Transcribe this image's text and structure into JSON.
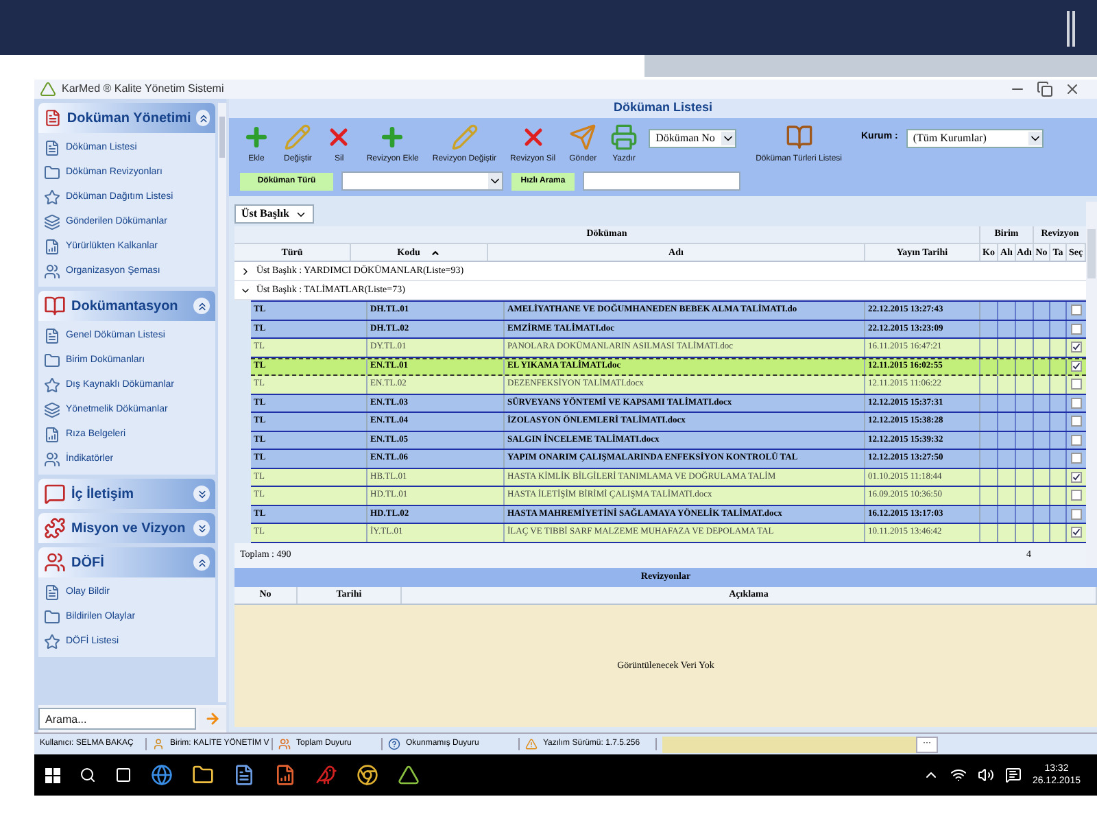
{
  "window": {
    "title": "KarMed ® Kalite Yönetim Sistemi"
  },
  "sidebar": {
    "sections": [
      {
        "title": "Doküman Yönetimi",
        "expanded": true,
        "items": [
          "Döküman Listesi",
          "Döküman Revizyonları",
          "Döküman Dağıtım Listesi",
          "Gönderilen Dökümanlar",
          "Yürürlükten Kalkanlar",
          "Organizasyon Şeması"
        ]
      },
      {
        "title": "Dokümantasyon",
        "expanded": true,
        "items": [
          "Genel Döküman Listesi",
          "Birim Dokümanları",
          "Dış Kaynaklı Dökümanlar",
          "Yönetmelik Dökümanlar",
          "Rıza Belgeleri",
          "İndikatörler"
        ]
      },
      {
        "title": "İç İletişim",
        "expanded": false
      },
      {
        "title": "Misyon ve Vizyon",
        "expanded": false
      },
      {
        "title": "DÖFİ",
        "expanded": true,
        "items": [
          "Olay Bildir",
          "Bildirilen Olaylar",
          "DÖFİ Listesi"
        ]
      }
    ],
    "search": {
      "placeholder": "Arama..."
    }
  },
  "main": {
    "title": "Döküman Listesi",
    "toolbar": [
      {
        "label": "Ekle",
        "kind": "add"
      },
      {
        "label": "Değiştir",
        "kind": "edit"
      },
      {
        "label": "Sil",
        "kind": "delete"
      },
      {
        "label": "Revizyon Ekle",
        "kind": "add"
      },
      {
        "label": "Revizyon Değiştir",
        "kind": "edit"
      },
      {
        "label": "Revizyon Sil",
        "kind": "delete"
      },
      {
        "label": "Gönder",
        "kind": "send"
      },
      {
        "label": "Yazdır",
        "kind": "print"
      }
    ],
    "sort_select": {
      "value": "Döküman No"
    },
    "types_button": {
      "label": "Döküman Türleri Listesi"
    },
    "institution": {
      "label": "Kurum :",
      "value": "(Tüm Kurumlar)"
    },
    "filters": {
      "type_button": "Döküman Türü",
      "quick_search_button": "Hızlı Arama"
    },
    "grid": {
      "group_by": "Üst Başlık",
      "bands": [
        "Döküman",
        "Birim",
        "Revizyon"
      ],
      "columns": [
        "Türü",
        "Kodu",
        "Adı",
        "Yayın Tarihi",
        "Ko",
        "Alı",
        "Adı",
        "No",
        "Ta",
        "Seç"
      ],
      "groups": [
        {
          "label": "Üst Başlık : YARDIMCI DÖKÜMANLAR(Liste=93)",
          "expanded": false
        },
        {
          "label": "Üst Başlık : TALİMATLAR(Liste=73)",
          "expanded": true
        }
      ],
      "rows": [
        {
          "type": "TL",
          "code": "DH.TL.01",
          "name": "AMELİYATHANE VE DOĞUMHANEDEN BEBEK ALMA TALİMATI.do",
          "date": "22.12.2015 13:27:43",
          "highlighted": true,
          "selected": false,
          "checked": false
        },
        {
          "type": "TL",
          "code": "DH.TL.02",
          "name": "EMZİRME TALİMATI.doc",
          "date": "22.12.2015 13:23:09",
          "highlighted": true,
          "selected": false,
          "checked": false
        },
        {
          "type": "TL",
          "code": "DY.TL.01",
          "name": "PANOLARA DOKÜMANLARIN ASILMASI TALİMATI.doc",
          "date": "16.11.2015 16:47:21",
          "highlighted": false,
          "selected": false,
          "checked": true
        },
        {
          "type": "TL",
          "code": "EN.TL.01",
          "name": "EL YIKAMA TALİMATI.doc",
          "date": "12.11.2015 16:02:55",
          "highlighted": false,
          "selected": true,
          "checked": true
        },
        {
          "type": "TL",
          "code": "EN.TL.02",
          "name": "DEZENFEKSİYON TALİMATI.docx",
          "date": "12.11.2015 11:06:22",
          "highlighted": false,
          "selected": false,
          "checked": false
        },
        {
          "type": "TL",
          "code": "EN.TL.03",
          "name": "SÜRVEYANS YÖNTEMİ VE KAPSAMI TALİMATI.docx",
          "date": "12.12.2015 15:37:31",
          "highlighted": true,
          "selected": false,
          "checked": false
        },
        {
          "type": "TL",
          "code": "EN.TL.04",
          "name": "İZOLASYON ÖNLEMLERİ TALİMATI.docx",
          "date": "12.12.2015 15:38:28",
          "highlighted": true,
          "selected": false,
          "checked": false
        },
        {
          "type": "TL",
          "code": "EN.TL.05",
          "name": "SALGIN İNCELEME TALİMATI.docx",
          "date": "12.12.2015 15:39:32",
          "highlighted": true,
          "selected": false,
          "checked": false
        },
        {
          "type": "TL",
          "code": "EN.TL.06",
          "name": "YAPIM ONARIM ÇALIŞMALARINDA ENFEKSİYON KONTROLÜ TAL",
          "date": "12.12.2015 13:27:50",
          "highlighted": true,
          "selected": false,
          "checked": false
        },
        {
          "type": "TL",
          "code": "HB.TL.01",
          "name": "HASTA KİMLİK BİLGİLERİ TANIMLAMA VE DOĞRULAMA TALİM",
          "date": "01.10.2015 11:18:44",
          "highlighted": false,
          "selected": false,
          "checked": true
        },
        {
          "type": "TL",
          "code": "HD.TL.01",
          "name": "HASTA İLETİŞİM BİRİMİ ÇALIŞMA TALİMATI.docx",
          "date": "16.09.2015 10:36:50",
          "highlighted": false,
          "selected": false,
          "checked": false
        },
        {
          "type": "TL",
          "code": "HD.TL.02",
          "name": "HASTA MAHREMİYETİNİ SAĞLAMAYA YÖNELİK TALİMAT.docx",
          "date": "16.12.2015 13:17:03",
          "highlighted": true,
          "selected": false,
          "checked": false
        },
        {
          "type": "TL",
          "code": "İY.TL.01",
          "name": "İLAÇ VE TIBBİ SARF MALZEME MUHAFAZA VE DEPOLAMA TAL",
          "date": "10.11.2015 13:46:42",
          "highlighted": false,
          "selected": false,
          "checked": true
        }
      ],
      "footer": {
        "total": "Toplam : 490",
        "count": "4"
      }
    },
    "revisions": {
      "title": "Revizyonlar",
      "columns": [
        "No",
        "Tarihi",
        "Açıklama"
      ],
      "empty": "Görüntülenecek Veri Yok"
    }
  },
  "status_bar": {
    "user": "Kullanıcı: SELMA BAKAÇ",
    "unit": "Birim: KALİTE YÖNETİM V",
    "total": "Toplam Duyuru",
    "unread": "Okunmamış Duyuru",
    "version": "Yazılım Sürümü: 1.7.5.256",
    "more": "···"
  },
  "taskbar": {
    "time": "13:32",
    "date": "26.12.2015"
  }
}
